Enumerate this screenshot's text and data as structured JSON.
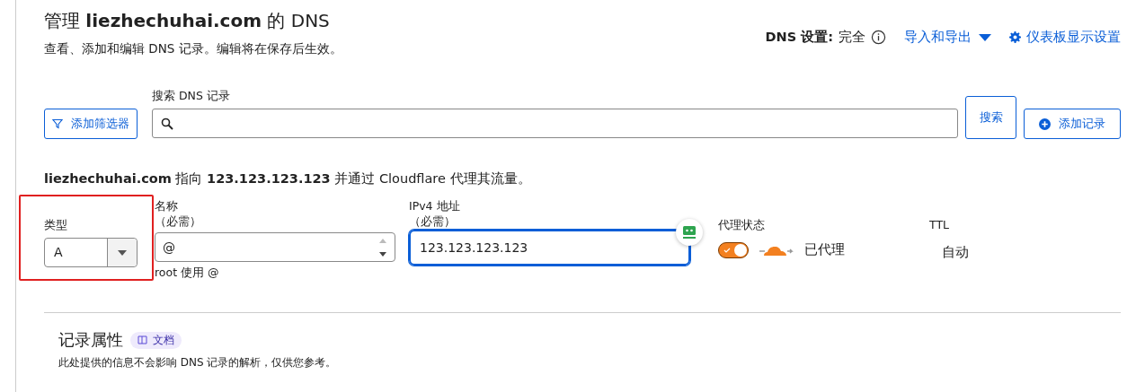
{
  "header": {
    "title": "管理 **liezhechuhai.com** 的 DNS",
    "subtitle": "查看、添加和编辑 DNS 记录。编辑将在保存后生效。"
  },
  "settings": {
    "label": "DNS 设置:",
    "value": "完全",
    "import_export": "导入和导出",
    "dashboard_settings": "仪表板显示设置"
  },
  "search": {
    "label": "搜索 DNS 记录",
    "filter_button": "添加筛选器",
    "search_button": "搜索",
    "add_button": "添加记录"
  },
  "summary": "**liezhechuhai.com** 指向 **123.123.123.123** 并通过 Cloudflare 代理其流量。",
  "record": {
    "type": {
      "label": "类型",
      "value": "A",
      "highlighted": true
    },
    "name": {
      "label": "名称",
      "required": "（必需）",
      "value": "@",
      "hint": "root 使用 @"
    },
    "ipv4": {
      "label": "IPv4 地址",
      "required": "（必需）",
      "value": "123.123.123.123",
      "focused": true
    },
    "proxy": {
      "label": "代理状态",
      "on": true,
      "status": "已代理"
    },
    "ttl": {
      "label": "TTL",
      "value": "自动"
    }
  },
  "attributes": {
    "title": "记录属性",
    "docs_badge": "文档",
    "description": "此处提供的信息不会影响 DNS 记录的解析，仅供您参考。"
  }
}
